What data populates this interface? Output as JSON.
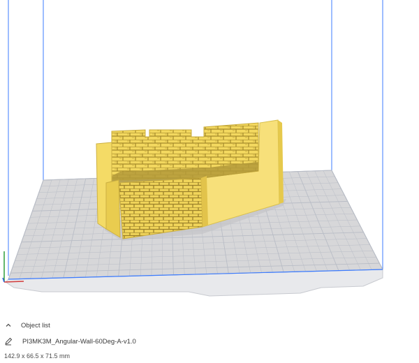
{
  "viewport": {
    "build_volume_color": "#3b7bff",
    "plate_color": "#d7d7d9",
    "grid_color": "#b9bdc6",
    "model_color": "#f5de6a",
    "model_shadow_color": "#c9ad3a"
  },
  "panel": {
    "object_list_label": "Object list",
    "object_list_icon": "chevron-up-icon",
    "object_name": "PI3MK3M_Angular-Wall-60Deg-A-v1.0",
    "edit_icon": "pencil-icon",
    "dimensions": "142.9 x 66.5 x 71.5 mm"
  }
}
